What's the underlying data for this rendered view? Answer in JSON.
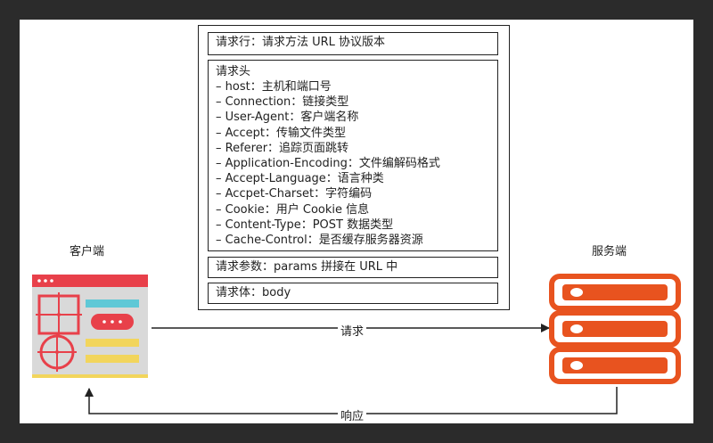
{
  "client_label": "客户端",
  "server_label": "服务端",
  "request_arrow_label": "请求",
  "response_arrow_label": "响应",
  "request_line": "请求行：请求方法 URL 协议版本",
  "headers": {
    "title": "请求头",
    "items": [
      "– host：主机和端口号",
      "– Connection：链接类型",
      "– User-Agent：客户端名称",
      "– Accept：传输文件类型",
      "– Referer：追踪页面跳转",
      "– Application-Encoding：文件编解码格式",
      "– Accept-Language：语言种类",
      "– Accpet-Charset：字符编码",
      "– Cookie：用户 Cookie 信息",
      "– Content-Type：POST 数据类型",
      "– Cache-Control：是否缓存服务器资源"
    ]
  },
  "params_line": "请求参数：params 拼接在 URL 中",
  "body_line": "请求体：body",
  "colors": {
    "server_orange": "#e8531f",
    "client_red": "#e8404a",
    "client_cyan": "#5fc8d6",
    "client_yellow": "#f2d55c",
    "client_gray": "#d9d9d9"
  }
}
